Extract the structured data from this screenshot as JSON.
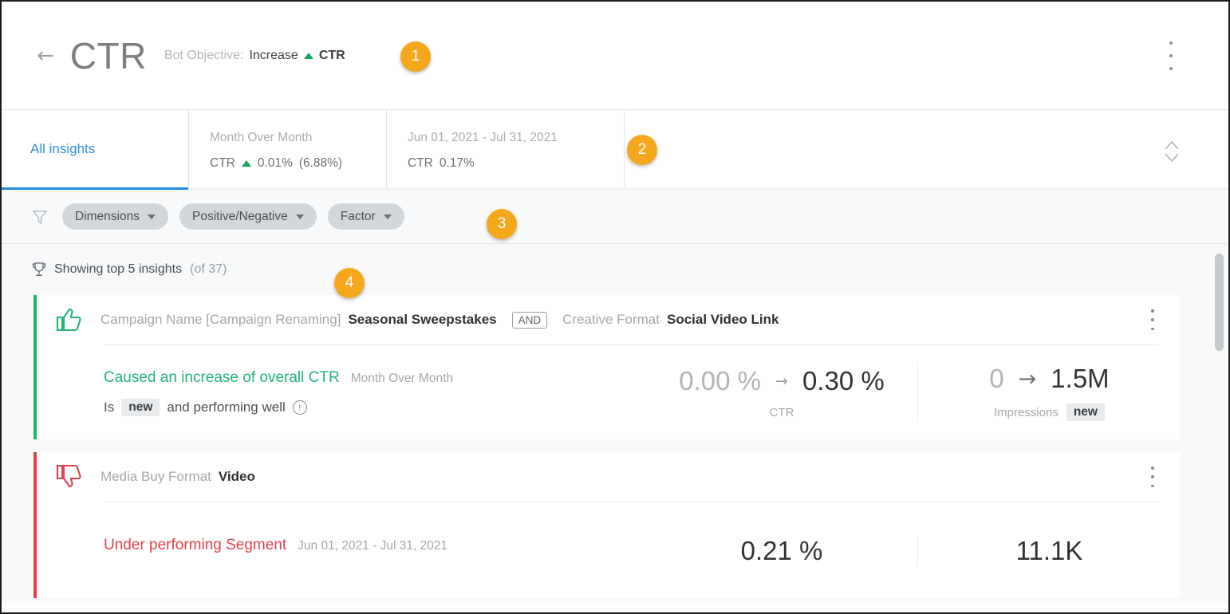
{
  "header": {
    "back_icon": "arrow-left-icon",
    "title": "CTR",
    "objective_label": "Bot Objective:",
    "objective_verb": "Increase",
    "objective_trend_icon": "triangle-up-icon",
    "objective_metric": "CTR",
    "menu_icon": "kebab-menu-icon"
  },
  "summary": {
    "tab_label": "All insights",
    "blocks": [
      {
        "title": "Month Over Month",
        "metric_name": "CTR",
        "trend_icon": "triangle-up-icon",
        "value": "0.01%",
        "percent": "(6.88%)"
      },
      {
        "title": "Jun 01, 2021 - Jul 31, 2021",
        "metric_name": "CTR",
        "value": "0.17%"
      }
    ],
    "expand_icon": "chevron-up-down-icon"
  },
  "filters": {
    "funnel_icon": "filter-funnel-icon",
    "chips": [
      {
        "label": "Dimensions",
        "icon": "chevron-down-icon"
      },
      {
        "label": "Positive/Negative",
        "icon": "chevron-down-icon"
      },
      {
        "label": "Factor",
        "icon": "chevron-down-icon"
      }
    ]
  },
  "results": {
    "trophy_icon": "trophy-icon",
    "showing_text": "Showing top 5 insights",
    "showing_count": "(of 37)",
    "cards": [
      {
        "sentiment": "positive",
        "sentiment_icon": "thumbs-up-icon",
        "accent_color": "#22b573",
        "criteria": [
          {
            "dimension": "Campaign Name [Campaign Renaming]",
            "value": "Seasonal Sweepstakes"
          },
          {
            "dimension": "Creative Format",
            "value": "Social Video Link"
          }
        ],
        "conjunction": "AND",
        "menu_icon": "kebab-menu-icon",
        "verdict": "Caused an increase of overall CTR",
        "period": "Month Over Month",
        "sub_prefix": "Is",
        "sub_tag": "new",
        "sub_suffix": "and performing well",
        "info_icon": "info-circle-icon",
        "metrics": [
          {
            "from": "0.00 %",
            "arrow": "→",
            "to": "0.30 %",
            "label": "CTR",
            "tag": ""
          },
          {
            "from": "0",
            "arrow": "→",
            "to": "1.5M",
            "label": "Impressions",
            "tag": "new"
          }
        ]
      },
      {
        "sentiment": "negative",
        "sentiment_icon": "thumbs-down-icon",
        "accent_color": "#e0424d",
        "criteria": [
          {
            "dimension": "Media Buy Format",
            "value": "Video"
          }
        ],
        "conjunction": "",
        "menu_icon": "kebab-menu-icon",
        "verdict": "Under performing Segment",
        "period": "Jun 01, 2021 - Jul 31, 2021",
        "sub_prefix": "",
        "sub_tag": "",
        "sub_suffix": "",
        "info_icon": "",
        "metrics": [
          {
            "from": "",
            "arrow": "",
            "to": "0.21 %",
            "label": "",
            "tag": ""
          },
          {
            "from": "",
            "arrow": "",
            "to": "11.1K",
            "label": "",
            "tag": ""
          }
        ]
      }
    ]
  },
  "callouts": [
    {
      "number": "1"
    },
    {
      "number": "2"
    },
    {
      "number": "3"
    },
    {
      "number": "4"
    }
  ],
  "scrollbar": {
    "name": "vertical-scrollbar"
  }
}
